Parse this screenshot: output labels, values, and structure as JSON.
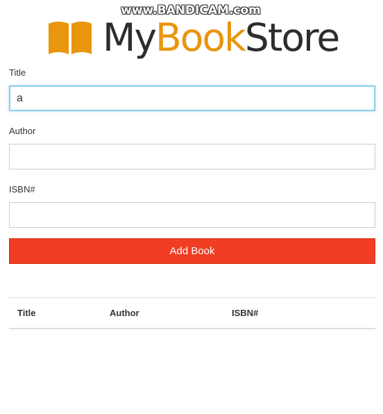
{
  "watermark": {
    "text": "www.BANDICAM.com"
  },
  "logo": {
    "part_my": "My",
    "part_book": "Book",
    "part_store": "Store",
    "icon": "open-book-icon",
    "colors": {
      "dark": "#2d2d2d",
      "accent": "#e8960e"
    }
  },
  "form": {
    "title": {
      "label": "Title",
      "value": "a",
      "placeholder": ""
    },
    "author": {
      "label": "Author",
      "value": "",
      "placeholder": ""
    },
    "isbn": {
      "label": "ISBN#",
      "value": "",
      "placeholder": ""
    },
    "submit_label": "Add Book",
    "submit_color": "#f03d24",
    "focus_color": "#8ed1ea"
  },
  "table": {
    "columns": [
      "Title",
      "Author",
      "ISBN#"
    ],
    "rows": []
  }
}
